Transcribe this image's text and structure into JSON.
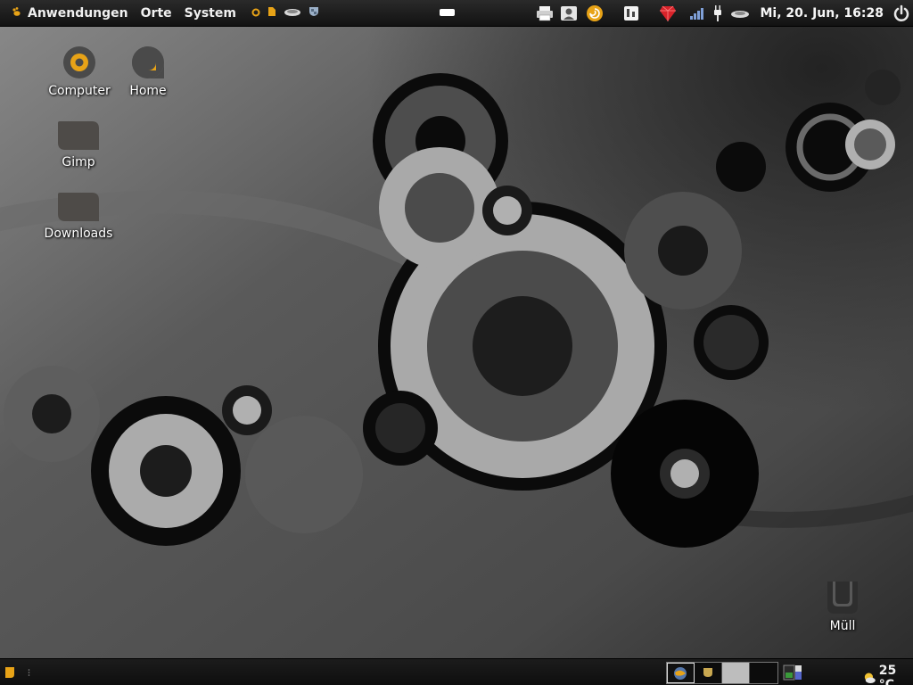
{
  "top_panel": {
    "menus": [
      {
        "label": "Anwendungen",
        "icon": "gnome-foot-icon"
      },
      {
        "label": "Orte"
      },
      {
        "label": "System"
      }
    ],
    "launchers": [
      "bulb-icon",
      "note-icon",
      "mouse-icon",
      "shield-icon"
    ],
    "tray": [
      "printer-icon",
      "user-switch-icon",
      "shell-icon",
      "audio-icon",
      "ruby-icon",
      "signal-icon",
      "power-plug-icon",
      "mouse-icon"
    ],
    "clock": "Mi, 20. Jun, 16:28",
    "shutdown_icon": "power-icon"
  },
  "desktop": {
    "icons": [
      {
        "label": "Computer",
        "icon": "computer-icon"
      },
      {
        "label": "Home",
        "icon": "home-icon"
      },
      {
        "label": "Gimp",
        "icon": "folder-icon"
      },
      {
        "label": "Downloads",
        "icon": "folder-icon"
      },
      {
        "label": "Müll",
        "icon": "trash-icon"
      }
    ]
  },
  "bottom_panel": {
    "workspaces": 4,
    "weather": {
      "temperature": "25 °C",
      "icon": "partly-sunny-icon"
    }
  },
  "colors": {
    "accent": "#e8a317",
    "panel": "#1a1a1a",
    "icon_gray": "#4a4a4a"
  }
}
